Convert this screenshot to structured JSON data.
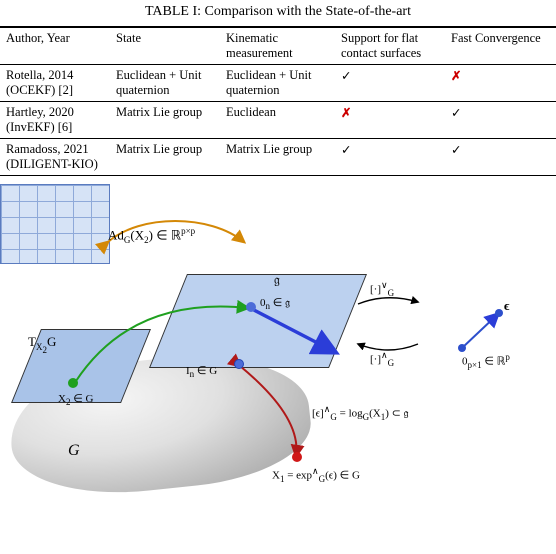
{
  "caption": "TABLE I: Comparison with the State-of-the-art",
  "headers": {
    "author": "Author, Year",
    "state": "State",
    "kin": "Kinematic measurement",
    "flat": "Support for flat contact surfaces",
    "conv": "Fast Convergence"
  },
  "rows": [
    {
      "author": "Rotella, 2014 (OCEKF) [2]",
      "state": "Euclidean + Unit quaternion",
      "kin": "Euclidean + Unit quaternion",
      "flat": "✓",
      "conv": "✗"
    },
    {
      "author": "Hartley, 2020 (InvEKF) [6]",
      "state": "Matrix Lie group",
      "kin": "Euclidean",
      "flat": "✗",
      "conv": "✓"
    },
    {
      "author": "Ramadoss, 2021 (DILIGENT-KIO)",
      "state": "Matrix Lie group",
      "kin": "Matrix Lie group",
      "flat": "✓",
      "conv": "✓"
    }
  ],
  "fig": {
    "adg": "Ad_G(X₂) ∈ ℝ^{p×p}",
    "tx2g": "T_{X₂}G",
    "gothg": "𝔤",
    "zero_n": "0_n ∈ 𝔤",
    "vee": "[·]^{∨}_G",
    "wedge": "[·]^{∧}_G",
    "eps": "ϵ",
    "zero_p": "0_{p×1} ∈ ℝ^p",
    "x2": "X₂ ∈ G",
    "In": "I_n ∈ G",
    "G": "G",
    "logmap": "[ϵ]^{∧}_G = log_G(X₁) ⊂ 𝔤",
    "x1exp": "X₁ = exp^{∧}_G(ϵ) ∈ G"
  },
  "chart_data": {
    "type": "table",
    "title": "Comparison with the State-of-the-art",
    "columns": [
      "Author, Year",
      "State",
      "Kinematic measurement",
      "Support for flat contact surfaces",
      "Fast Convergence"
    ],
    "rows": [
      [
        "Rotella, 2014 (OCEKF) [2]",
        "Euclidean + Unit quaternion",
        "Euclidean + Unit quaternion",
        true,
        false
      ],
      [
        "Hartley, 2020 (InvEKF) [6]",
        "Matrix Lie group",
        "Euclidean",
        false,
        true
      ],
      [
        "Ramadoss, 2021 (DILIGENT-KIO)",
        "Matrix Lie group",
        "Matrix Lie group",
        true,
        true
      ]
    ]
  }
}
